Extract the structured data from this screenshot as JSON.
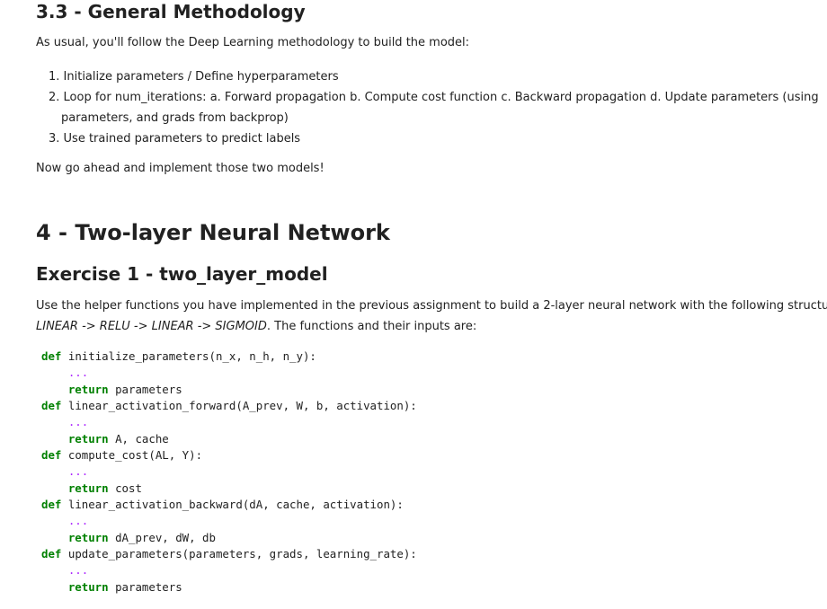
{
  "section_3_3": {
    "heading": "3.3 - General Methodology",
    "intro": "As usual, you'll follow the Deep Learning methodology to build the model:",
    "steps": [
      "1. Initialize parameters / Define hyperparameters",
      "2. Loop for num_iterations: a. Forward propagation b. Compute cost function c. Backward propagation d. Update parameters (using",
      "parameters, and grads from backprop)",
      "3. Use trained parameters to predict labels"
    ],
    "outro": "Now go ahead and implement those two models!"
  },
  "section_4": {
    "heading": "4 - Two-layer Neural Network",
    "exercise_heading": "Exercise 1 - two_layer_model",
    "intro_line1": "Use the helper functions you have implemented in the previous assignment to build a 2-layer neural network with the following structure:",
    "structure": "LINEAR -> RELU -> LINEAR -> SIGMOID",
    "intro_line2_rest": ". The functions and their inputs are:"
  },
  "code": {
    "def_kw": "def",
    "return_kw": "return",
    "dots": "...",
    "functions": [
      {
        "signature": "initialize_parameters(n_x, n_h, n_y):",
        "returns": "parameters"
      },
      {
        "signature": "linear_activation_forward(A_prev, W, b, activation):",
        "returns": "A, cache"
      },
      {
        "signature": "compute_cost(AL, Y):",
        "returns": "cost"
      },
      {
        "signature": "linear_activation_backward(dA, cache, activation):",
        "returns": "dA_prev, dW, db"
      },
      {
        "signature": "update_parameters(parameters, grads, learning_rate):",
        "returns": "parameters"
      }
    ]
  }
}
